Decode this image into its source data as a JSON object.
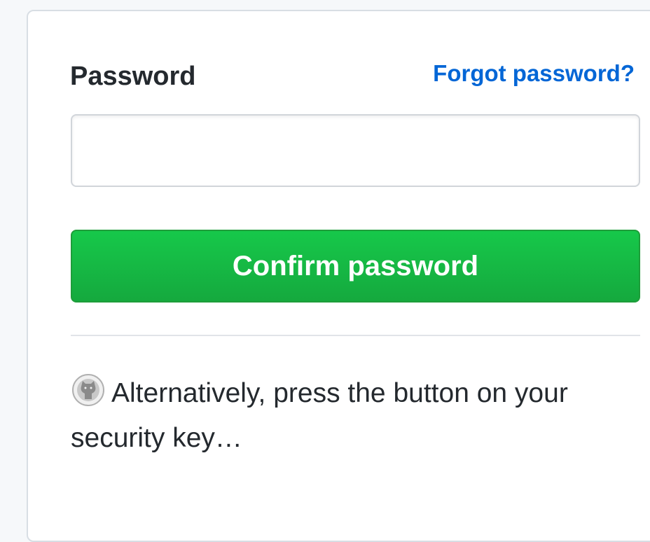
{
  "form": {
    "password_label": "Password",
    "forgot_link": "Forgot password?",
    "password_value": "",
    "confirm_button": "Confirm password",
    "alternative_text": "Alternatively, press the button on your security key…"
  },
  "icons": {
    "security_key": "octocat-icon"
  },
  "colors": {
    "link": "#0366d6",
    "button_green": "#16c84a",
    "text": "#24292e"
  }
}
